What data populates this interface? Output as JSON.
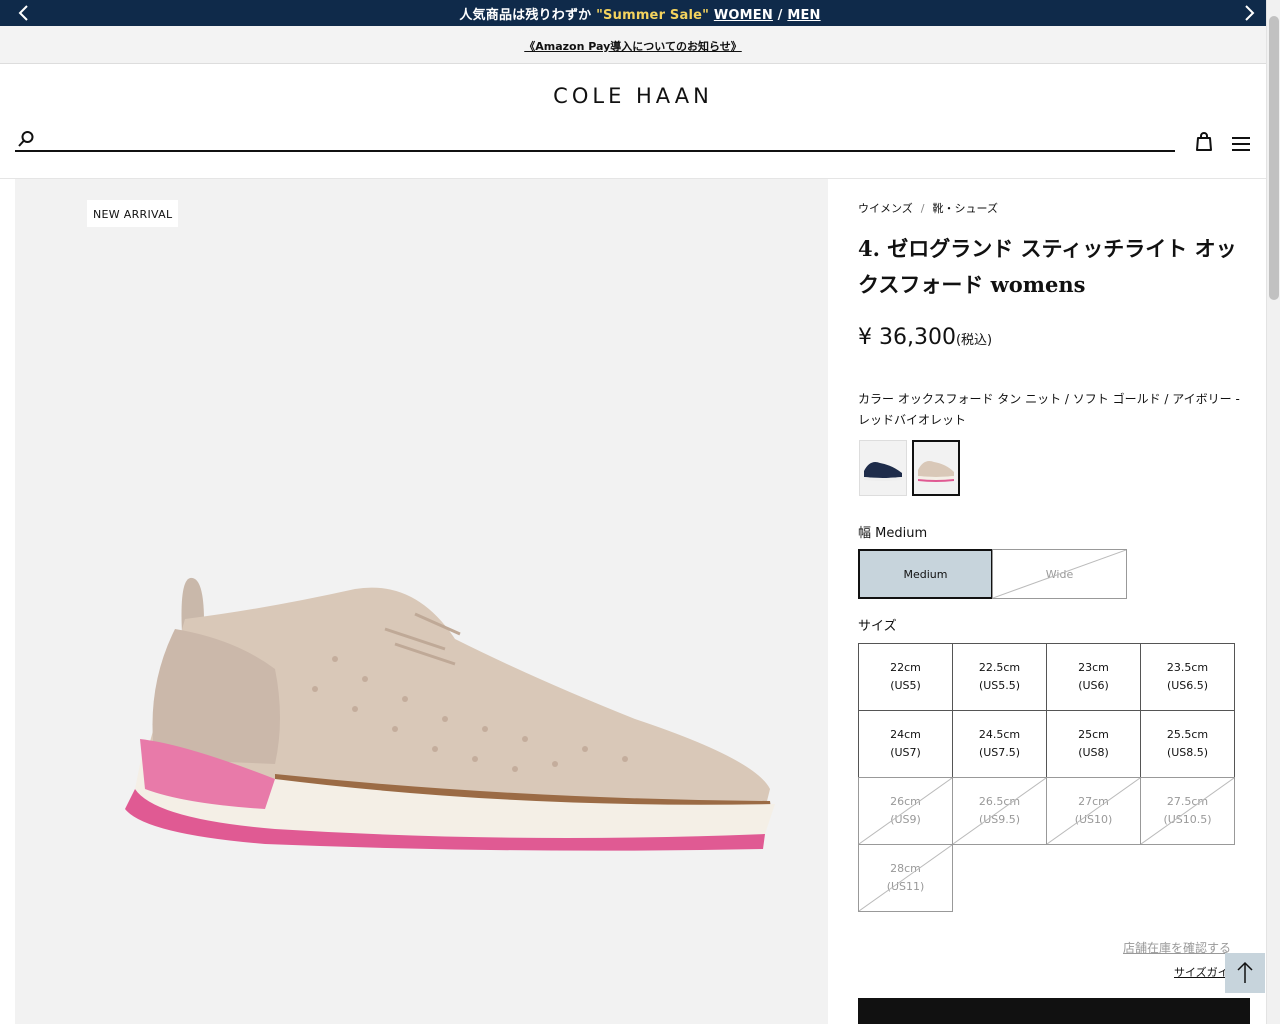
{
  "promo": {
    "prefix": "人気商品は残りわずか ",
    "sale": "\"Summer Sale\"",
    "women": "WOMEN",
    "sep": " / ",
    "men": "MEN"
  },
  "notice": {
    "text": "《Amazon Pay導入についてのお知らせ》"
  },
  "header": {
    "logo": "COLE HAAN",
    "search_placeholder": ""
  },
  "gallery": {
    "badge": "NEW ARRIVAL"
  },
  "product": {
    "breadcrumb": [
      "ウイメンズ",
      "/",
      "靴・シューズ"
    ],
    "title": "4. ゼログランド スティッチライト オックスフォード womens",
    "price": "¥ 36,300",
    "tax": "(税込)",
    "color_label": "カラー オックスフォード タン ニット / ソフト ゴールド / アイボリー - レッドバイオレット",
    "width_label": "幅 Medium",
    "widths": [
      {
        "label": "Medium",
        "selected": true,
        "available": true
      },
      {
        "label": "Wide",
        "selected": false,
        "available": false
      }
    ],
    "size_label": "サイズ",
    "sizes": [
      {
        "cm": "22cm",
        "us": "(US5)",
        "available": true
      },
      {
        "cm": "22.5cm",
        "us": "(US5.5)",
        "available": true
      },
      {
        "cm": "23cm",
        "us": "(US6)",
        "available": true
      },
      {
        "cm": "23.5cm",
        "us": "(US6.5)",
        "available": true
      },
      {
        "cm": "24cm",
        "us": "(US7)",
        "available": true
      },
      {
        "cm": "24.5cm",
        "us": "(US7.5)",
        "available": true
      },
      {
        "cm": "25cm",
        "us": "(US8)",
        "available": true
      },
      {
        "cm": "25.5cm",
        "us": "(US8.5)",
        "available": true
      },
      {
        "cm": "26cm",
        "us": "(US9)",
        "available": false
      },
      {
        "cm": "26.5cm",
        "us": "(US9.5)",
        "available": false
      },
      {
        "cm": "27cm",
        "us": "(US10)",
        "available": false
      },
      {
        "cm": "27.5cm",
        "us": "(US10.5)",
        "available": false
      },
      {
        "cm": "28cm",
        "us": "(US11)",
        "available": false
      }
    ],
    "store_link": "店舗在庫を確認する",
    "guide_link": "サイズガイ"
  },
  "colors": {
    "navy": "#0f2a4a",
    "sale_yellow": "#f4d35e",
    "selected_bg": "#c7d4dc",
    "shoe_knit": "#d9c8b8",
    "shoe_sole_pink": "#e05a93"
  },
  "icons": [
    "chevron-left-icon",
    "chevron-right-icon",
    "search-icon",
    "shopping-bag-icon",
    "hamburger-menu-icon",
    "arrow-up-icon"
  ]
}
